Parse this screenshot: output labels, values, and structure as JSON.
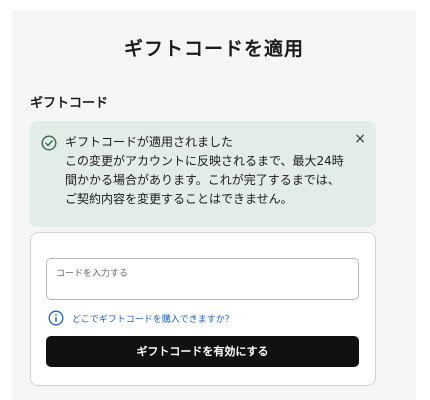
{
  "page": {
    "title": "ギフトコードを適用",
    "section_label": "ギフトコード"
  },
  "alert": {
    "icon": "check-circle-icon",
    "title": "ギフトコードが適用されました",
    "body": "この変更がアカウントに反映されるまで、最大24時\n間かかる場合があります。これが完了するまでは、\nご契約内容を変更することはできません。",
    "close_label": "×",
    "color": "#e3ede8"
  },
  "form": {
    "input_label": "コードを入力する",
    "input_value": "",
    "help_icon": "info-icon",
    "help_link": "どこでギフトコードを購入できますか？",
    "link_color": "#1f5fc9",
    "submit_label": "ギフトコードを有効にする",
    "button_color": "#111111"
  }
}
